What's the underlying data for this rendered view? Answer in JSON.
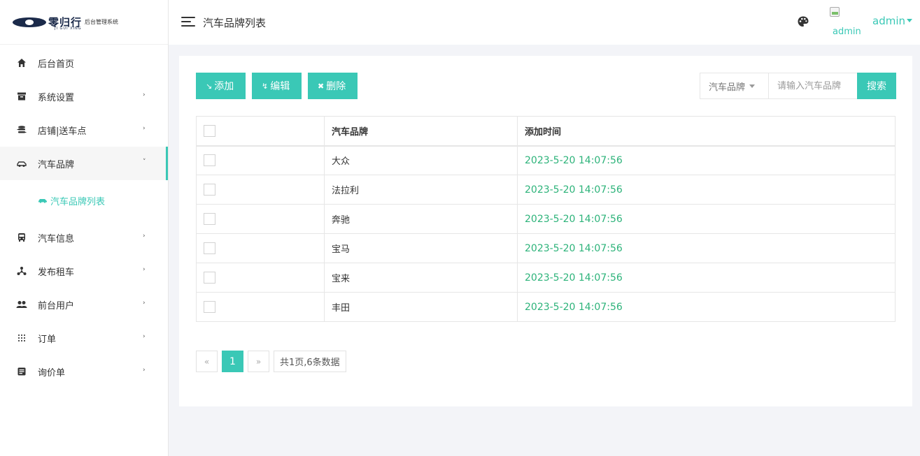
{
  "logo": {
    "text": "零归行",
    "pinyin": "JI GUI XING",
    "subtitle": "后台管理系统"
  },
  "sidebar": {
    "items": [
      {
        "label": "后台首页",
        "icon": "home-icon",
        "has_arrow": false
      },
      {
        "label": "系统设置",
        "icon": "archive-icon",
        "has_arrow": true
      },
      {
        "label": "店铺|送车点",
        "icon": "stack-icon",
        "has_arrow": true
      },
      {
        "label": "汽车品牌",
        "icon": "car-icon",
        "has_arrow": true,
        "expanded": true
      },
      {
        "label": "汽车信息",
        "icon": "bus-icon",
        "has_arrow": true
      },
      {
        "label": "发布租车",
        "icon": "network-icon",
        "has_arrow": true
      },
      {
        "label": "前台用户",
        "icon": "users-icon",
        "has_arrow": true
      },
      {
        "label": "订单",
        "icon": "grid-icon",
        "has_arrow": true
      },
      {
        "label": "询价单",
        "icon": "document-icon",
        "has_arrow": true
      }
    ],
    "active_sub": {
      "label": "汽车品牌列表",
      "icon": "car-icon"
    }
  },
  "header": {
    "title": "汽车品牌列表",
    "avatar_alt": "admin",
    "user": "admin"
  },
  "toolbar": {
    "add_label": "添加",
    "edit_label": "编辑",
    "delete_label": "删除"
  },
  "search": {
    "field": "汽车品牌",
    "placeholder": "请输入汽车品牌",
    "button": "搜索"
  },
  "table": {
    "columns": [
      "",
      "汽车品牌",
      "添加时间"
    ],
    "rows": [
      {
        "brand": "大众",
        "time": "2023-5-20 14:07:56"
      },
      {
        "brand": "法拉利",
        "time": "2023-5-20 14:07:56"
      },
      {
        "brand": "奔驰",
        "time": "2023-5-20 14:07:56"
      },
      {
        "brand": "宝马",
        "time": "2023-5-20 14:07:56"
      },
      {
        "brand": "宝来",
        "time": "2023-5-20 14:07:56"
      },
      {
        "brand": "丰田",
        "time": "2023-5-20 14:07:56"
      }
    ]
  },
  "pagination": {
    "prev": "«",
    "current": "1",
    "next": "»",
    "info": "共1页,6条数据"
  },
  "colors": {
    "accent": "#3ac8b6",
    "time_text": "#2db37a"
  }
}
